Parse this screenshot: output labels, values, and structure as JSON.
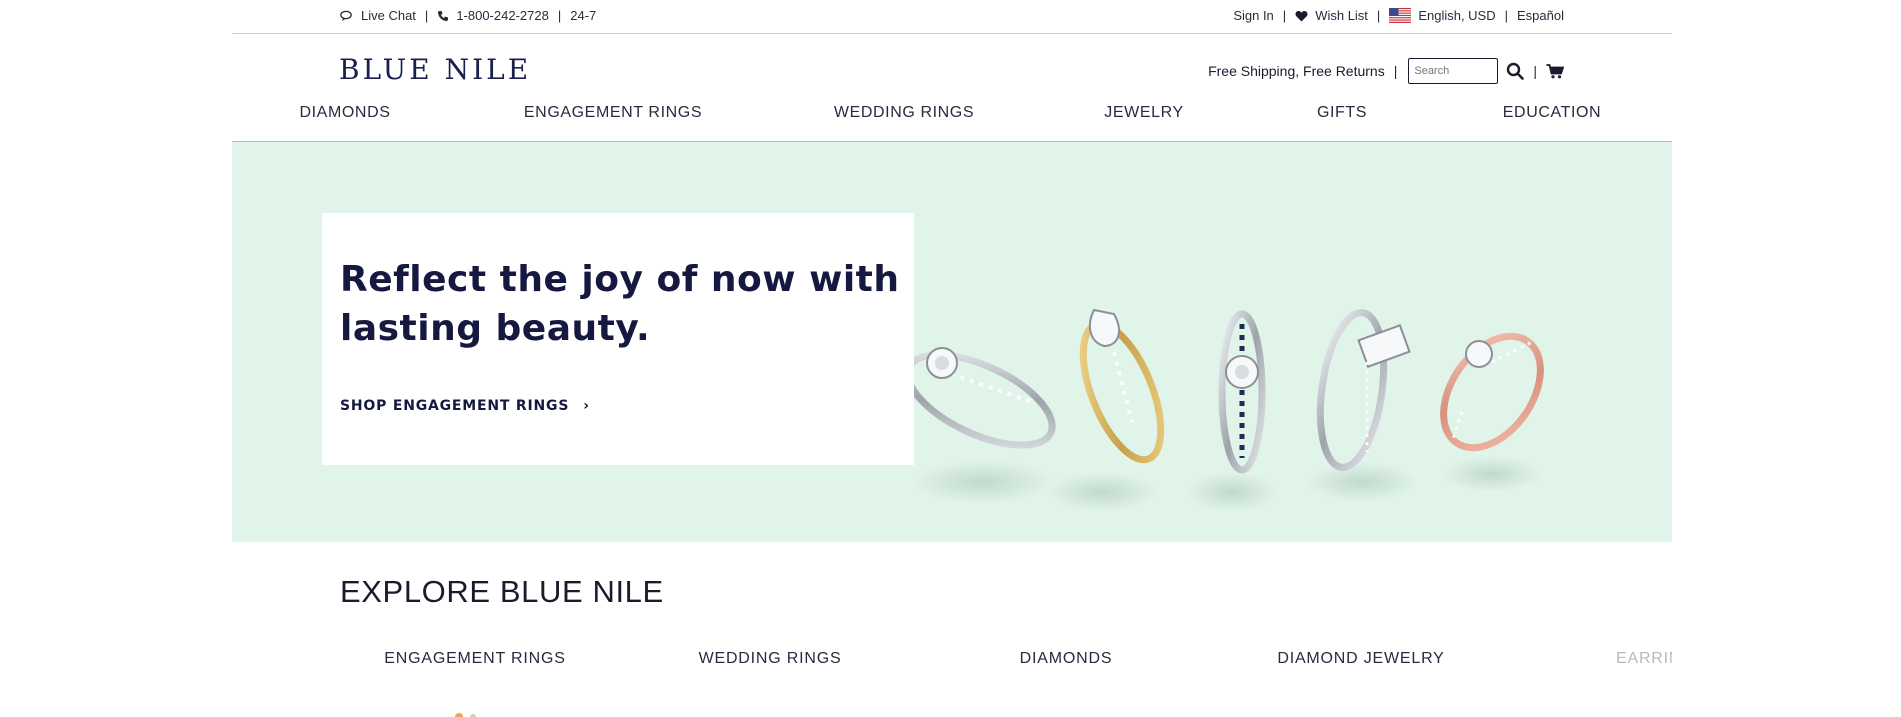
{
  "utility": {
    "live_chat": "Live Chat",
    "phone": "1-800-242-2728",
    "hours": "24-7",
    "sign_in": "Sign In",
    "wish_list": "Wish List",
    "locale": "English, USD",
    "language": "Español",
    "separator": "|"
  },
  "header": {
    "logo": "BLUE NILE",
    "shipping": "Free Shipping, Free Returns",
    "search_placeholder": "Search"
  },
  "nav": {
    "items": [
      "DIAMONDS",
      "ENGAGEMENT RINGS",
      "WEDDING RINGS",
      "JEWELRY",
      "GIFTS",
      "EDUCATION"
    ]
  },
  "hero": {
    "title": "Reflect the joy of now with lasting beauty.",
    "cta": "SHOP ENGAGEMENT RINGS",
    "cta_arrow": "›"
  },
  "explore": {
    "title": "EXPLORE BLUE NILE",
    "categories": [
      "ENGAGEMENT RINGS",
      "WEDDING RINGS",
      "DIAMONDS",
      "DIAMOND JEWELRY",
      "EARRIN"
    ]
  },
  "colors": {
    "brand_navy": "#15183f",
    "hero_bg": "#e0f4ea",
    "gold": "#d8b45a",
    "rose_gold": "#e4a898",
    "platinum": "#c9ccd2"
  }
}
